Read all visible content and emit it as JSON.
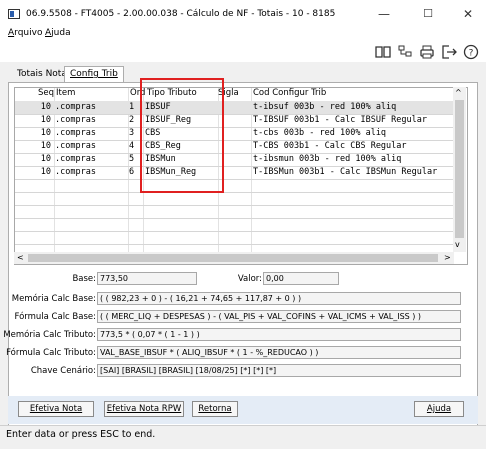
{
  "window": {
    "title": "06.9.5508 - FT4005 - 2.00.00.038 - Cálculo de NF - Totais - 10 - 8185",
    "minimize": "—",
    "maximize": "☐",
    "close": "✕"
  },
  "menu": [
    {
      "label": "Arquivo"
    },
    {
      "label": "Ajuda"
    }
  ],
  "toolbar": [
    "book-icon",
    "tree-icon",
    "print-icon",
    "exit-icon",
    "help-icon"
  ],
  "tabs": [
    {
      "label": "Totais Nota"
    },
    {
      "label": "Config Trib"
    }
  ],
  "grid": {
    "columns": [
      "Seq",
      "Item",
      "Ord",
      "Tipo Tributo",
      "Sigla",
      "Cod Configur Trib"
    ],
    "rows": [
      {
        "seq": "10",
        "item": ".compras",
        "ord": "1",
        "tipo": "IBSUF",
        "sigla": "",
        "cod": "t-ibsuf 003b - red 100% aliq"
      },
      {
        "seq": "10",
        "item": ".compras",
        "ord": "2",
        "tipo": "IBSUF_Reg",
        "sigla": "",
        "cod": "T-IBSUF 003b1 - Calc IBSUF Regular"
      },
      {
        "seq": "10",
        "item": ".compras",
        "ord": "3",
        "tipo": "CBS",
        "sigla": "",
        "cod": "t-cbs 003b - red 100% aliq"
      },
      {
        "seq": "10",
        "item": ".compras",
        "ord": "4",
        "tipo": "CBS_Reg",
        "sigla": "",
        "cod": "T-CBS 003b1 - Calc CBS Regular"
      },
      {
        "seq": "10",
        "item": ".compras",
        "ord": "5",
        "tipo": "IBSMun",
        "sigla": "",
        "cod": "t-ibsmun 003b - red 100% aliq"
      },
      {
        "seq": "10",
        "item": ".compras",
        "ord": "6",
        "tipo": "IBSMun_Reg",
        "sigla": "",
        "cod": "T-IBSMun 003b1 - Calc IBSMun Regular"
      }
    ]
  },
  "fields": {
    "base_label": "Base:",
    "base_value": "773,50",
    "valor_label": "Valor:",
    "valor_value": "0,00",
    "mem_calc_base_label": "Memória Calc Base:",
    "mem_calc_base_value": "( ( 982,23 + 0 ) - ( 16,21 + 74,65 + 117,87 + 0 ) )",
    "form_calc_base_label": "Fórmula Calc Base:",
    "form_calc_base_value": "( ( MERC_LIQ + DESPESAS ) - ( VAL_PIS + VAL_COFINS + VAL_ICMS + VAL_ISS ) )",
    "mem_calc_trib_label": "Memória Calc Tributo:",
    "mem_calc_trib_value": "773,5 * ( 0,07 * ( 1 - 1 ) )",
    "form_calc_trib_label": "Fórmula Calc Tributo:",
    "form_calc_trib_value": "VAL_BASE_IBSUF * ( ALIQ_IBSUF * ( 1 - %_REDUCAO ) )",
    "chave_label": "Chave Cenário:",
    "chave_value": "[SAI] [BRASIL] [BRASIL] [18/08/25] [*] [*] [*]"
  },
  "buttons": {
    "efetiva_nota": "Efetiva Nota",
    "efetiva_nota_rpw": "Efetiva Nota RPW",
    "retorna": "Retorna",
    "ajuda": "Ajuda"
  },
  "status": "Enter data or press ESC to end.",
  "colors": {
    "highlight": "#e02020",
    "button_bar": "#e4ecf6"
  }
}
